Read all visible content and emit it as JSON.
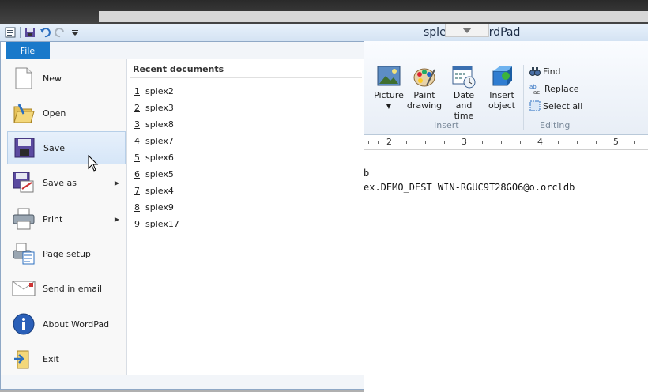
{
  "window": {
    "title": "splex2 - WordPad",
    "title_visible": "sple",
    "title_visible_end": "rdPad"
  },
  "quick_access": {
    "icons": [
      "wordpad-app-icon",
      "save-icon",
      "undo-icon",
      "redo-icon",
      "customize-qat-icon"
    ]
  },
  "file_tab": {
    "label": "File"
  },
  "file_menu": {
    "items": [
      {
        "label": "New",
        "icon": "new-document-icon"
      },
      {
        "label": "Open",
        "icon": "open-folder-icon"
      },
      {
        "label": "Save",
        "icon": "save-disk-icon"
      },
      {
        "label": "Save as",
        "icon": "save-as-icon"
      },
      {
        "label": "Print",
        "icon": "printer-icon"
      },
      {
        "label": "Page setup",
        "icon": "page-setup-icon"
      },
      {
        "label": "Send in email",
        "icon": "email-icon"
      },
      {
        "label": "About WordPad",
        "icon": "info-icon"
      },
      {
        "label": "Exit",
        "icon": "exit-icon"
      }
    ],
    "recent_header": "Recent documents",
    "recent": [
      {
        "num": "1",
        "name": "splex2"
      },
      {
        "num": "2",
        "name": "splex3"
      },
      {
        "num": "3",
        "name": "splex8"
      },
      {
        "num": "4",
        "name": "splex7"
      },
      {
        "num": "5",
        "name": "splex6"
      },
      {
        "num": "6",
        "name": "splex5"
      },
      {
        "num": "7",
        "name": "splex4"
      },
      {
        "num": "8",
        "name": "splex9"
      },
      {
        "num": "9",
        "name": "splex17"
      }
    ]
  },
  "ribbon": {
    "insert": {
      "picture": "Picture",
      "paint_1": "Paint",
      "paint_2": "drawing",
      "datetime_1": "Date and",
      "datetime_2": "time",
      "object_1": "Insert",
      "object_2": "object",
      "group": "Insert"
    },
    "editing": {
      "find": "Find",
      "replace": "Replace",
      "select_all": "Select all",
      "group": "Editing"
    }
  },
  "ruler": {
    "marks": [
      "2",
      "3",
      "4",
      "5"
    ]
  },
  "document": {
    "line1": "b",
    "line2": "ex.DEMO_DEST WIN-RGUC9T28GO6@o.orcldb"
  },
  "colors": {
    "file_tab": "#1979ca",
    "accent": "#1979ca"
  }
}
